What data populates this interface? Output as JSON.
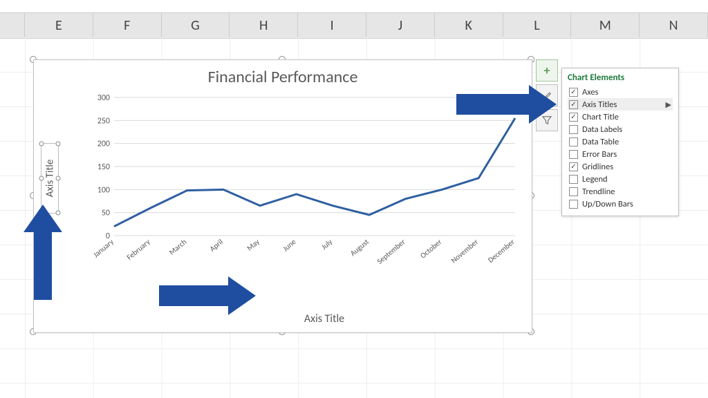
{
  "columns": [
    "E",
    "F",
    "G",
    "H",
    "I",
    "J",
    "K",
    "L",
    "M",
    "N"
  ],
  "chart": {
    "title": "Financial Performance",
    "x_axis_title": "Axis Title",
    "y_axis_title": "Axis Title"
  },
  "chart_data": {
    "type": "line",
    "categories": [
      "January",
      "February",
      "March",
      "April",
      "May",
      "June",
      "July",
      "August",
      "September",
      "October",
      "November",
      "December"
    ],
    "values": [
      20,
      60,
      98,
      100,
      65,
      90,
      65,
      45,
      80,
      100,
      125,
      255
    ],
    "title": "Financial Performance",
    "xlabel": "Axis Title",
    "ylabel": "Axis Title",
    "ylim": [
      0,
      300
    ],
    "y_ticks": [
      0,
      50,
      100,
      150,
      200,
      250,
      300
    ]
  },
  "side_buttons": {
    "plus": "+",
    "brush_icon": "brush-icon",
    "funnel_icon": "funnel-icon"
  },
  "flyout": {
    "title": "Chart Elements",
    "items": [
      {
        "label": "Axes",
        "checked": true,
        "highlight": false,
        "submenu": false
      },
      {
        "label": "Axis Titles",
        "checked": true,
        "highlight": true,
        "submenu": true
      },
      {
        "label": "Chart Title",
        "checked": true,
        "highlight": false,
        "submenu": false
      },
      {
        "label": "Data Labels",
        "checked": false,
        "highlight": false,
        "submenu": false
      },
      {
        "label": "Data Table",
        "checked": false,
        "highlight": false,
        "submenu": false
      },
      {
        "label": "Error Bars",
        "checked": false,
        "highlight": false,
        "submenu": false
      },
      {
        "label": "Gridlines",
        "checked": true,
        "highlight": false,
        "submenu": false
      },
      {
        "label": "Legend",
        "checked": false,
        "highlight": false,
        "submenu": false
      },
      {
        "label": "Trendline",
        "checked": false,
        "highlight": false,
        "submenu": false
      },
      {
        "label": "Up/Down Bars",
        "checked": false,
        "highlight": false,
        "submenu": false
      }
    ]
  },
  "colors": {
    "axis_text": "#595959",
    "series": "#2e5fa1",
    "grid": "#d9d9d9",
    "arrow": "#1f4ea1",
    "flyout_title": "#1e7a3e"
  }
}
